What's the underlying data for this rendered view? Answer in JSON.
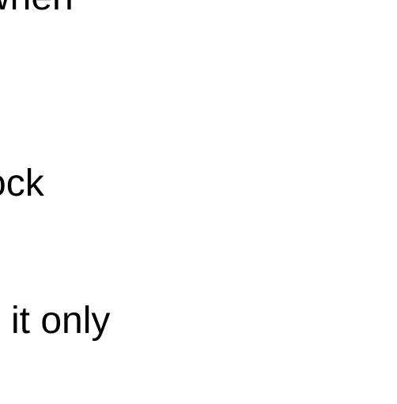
{
  "document": {
    "lines": [
      {
        "text": "when"
      },
      {
        "text": "ock"
      },
      {
        "text": "it only"
      }
    ]
  }
}
